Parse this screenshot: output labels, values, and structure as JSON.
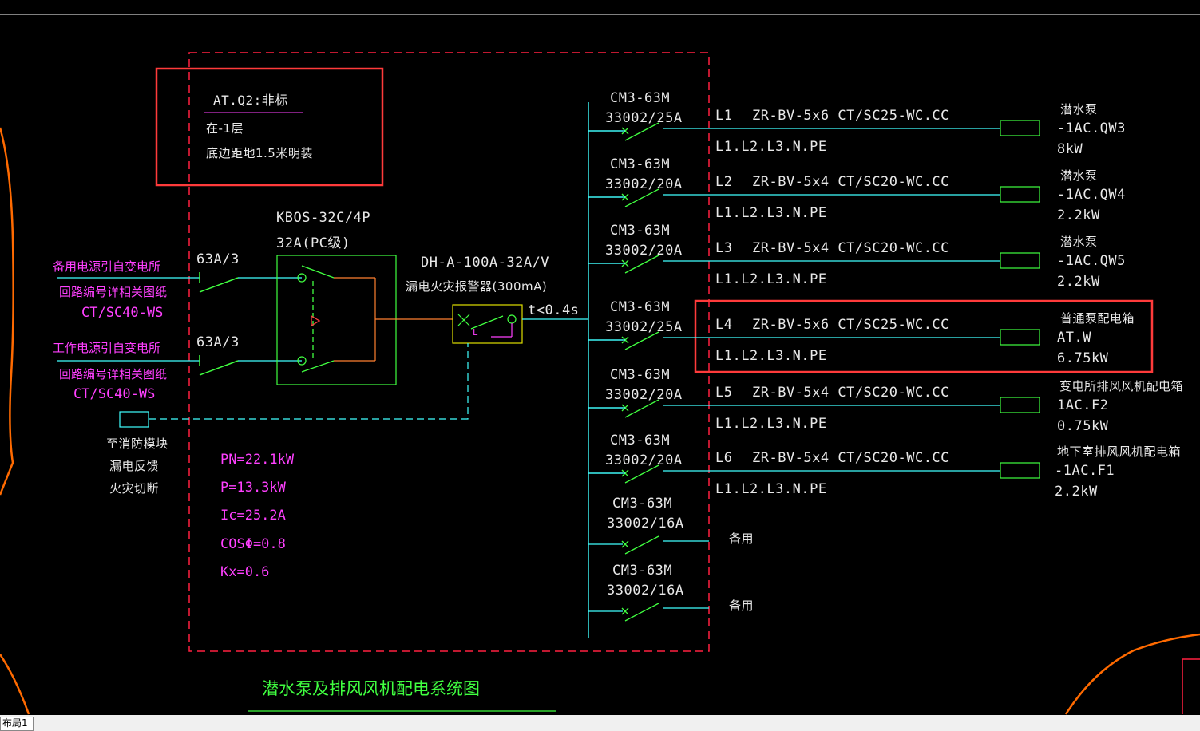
{
  "title": "潜水泵及排风风机配电系统图",
  "location_box": {
    "name": "AT.Q2:非标",
    "floor": "在-1层",
    "mount": "底边距地1.5米明装"
  },
  "inputs": [
    {
      "breaker": "63A/3",
      "source": "备用电源引自变电所",
      "note": "回路编号详相关图纸",
      "conduit": "CT/SC40-WS"
    },
    {
      "breaker": "63A/3",
      "source": "工作电源引自变电所",
      "note": "回路编号详相关图纸",
      "conduit": "CT/SC40-WS"
    }
  ],
  "ats": {
    "model": "KBOS-32C/4P",
    "rating": "32A(PC级)"
  },
  "leakage": {
    "model": "DH-A-100A-32A/V",
    "desc": "漏电火灾报警器(300mA)",
    "time": "t<0.4s"
  },
  "fire_module": {
    "lines": [
      "至消防模块",
      "漏电反馈",
      "火灾切断"
    ]
  },
  "load_calc": {
    "pn": "PN=22.1kW",
    "p": "P=13.3kW",
    "ic": "Ic=25.2A",
    "cos": "COSΦ=0.8",
    "kx": "Kx=0.6"
  },
  "circuits": [
    {
      "breaker": "CM3-63M",
      "setting": "33002/25A",
      "id": "L1",
      "cable": "ZR-BV-5x6 CT/SC25-WC.CC",
      "phases": "L1.L2.L3.N.PE",
      "load": "潜水泵",
      "code": "-1AC.QW3",
      "power": "8kW"
    },
    {
      "breaker": "CM3-63M",
      "setting": "33002/20A",
      "id": "L2",
      "cable": "ZR-BV-5x4 CT/SC20-WC.CC",
      "phases": "L1.L2.L3.N.PE",
      "load": "潜水泵",
      "code": "-1AC.QW4",
      "power": "2.2kW"
    },
    {
      "breaker": "CM3-63M",
      "setting": "33002/20A",
      "id": "L3",
      "cable": "ZR-BV-5x4 CT/SC20-WC.CC",
      "phases": "L1.L2.L3.N.PE",
      "load": "潜水泵",
      "code": "-1AC.QW5",
      "power": "2.2kW"
    },
    {
      "breaker": "CM3-63M",
      "setting": "33002/25A",
      "id": "L4",
      "cable": "ZR-BV-5x6 CT/SC25-WC.CC",
      "phases": "L1.L2.L3.N.PE",
      "load": "普通泵配电箱",
      "code": "AT.W",
      "power": "6.75kW"
    },
    {
      "breaker": "CM3-63M",
      "setting": "33002/20A",
      "id": "L5",
      "cable": "ZR-BV-5x4 CT/SC20-WC.CC",
      "phases": "L1.L2.L3.N.PE",
      "load": "变电所排风风机配电箱",
      "code": "1AC.F2",
      "power": "0.75kW"
    },
    {
      "breaker": "CM3-63M",
      "setting": "33002/20A",
      "id": "L6",
      "cable": "ZR-BV-5x4 CT/SC20-WC.CC",
      "phases": "L1.L2.L3.N.PE",
      "load": "地下室排风风机配电箱",
      "code": "-1AC.F1",
      "power": "2.2kW"
    }
  ],
  "spares": [
    {
      "breaker": "CM3-63M",
      "setting": "33002/16A",
      "label": "备用"
    },
    {
      "breaker": "CM3-63M",
      "setting": "33002/16A",
      "label": "备用"
    }
  ],
  "colors": {
    "frame": "#ff2040",
    "highlight": "#ff3b3b",
    "wire": "#40ffff",
    "device": "#40ff40",
    "text_white": "#e8e8e8",
    "text_magenta": "#ff40ff",
    "boundary": "#ff6a00"
  },
  "tabs": {
    "layout1": "布局1"
  }
}
